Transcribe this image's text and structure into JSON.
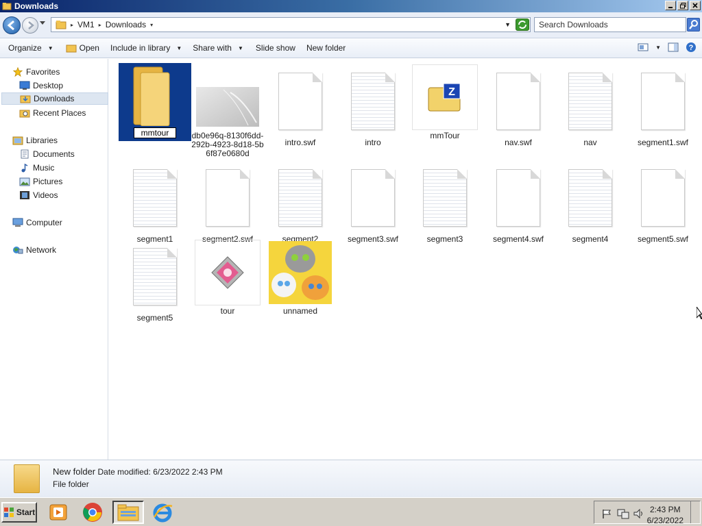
{
  "window": {
    "title": "Downloads"
  },
  "address": {
    "crumbs": [
      "VM1",
      "Downloads"
    ],
    "search_placeholder": "Search Downloads"
  },
  "toolbar": {
    "organize": "Organize",
    "open": "Open",
    "include_in_library": "Include in library",
    "share_with": "Share with",
    "slide_show": "Slide show",
    "new_folder": "New folder"
  },
  "nav": {
    "favorites": "Favorites",
    "desktop": "Desktop",
    "downloads": "Downloads",
    "recent_places": "Recent Places",
    "libraries": "Libraries",
    "documents": "Documents",
    "music": "Music",
    "pictures": "Pictures",
    "videos": "Videos",
    "computer": "Computer",
    "network": "Network"
  },
  "files": [
    {
      "name": "mmtour",
      "kind": "folder-renaming"
    },
    {
      "name": "db0e96q-8130f6dd-292b-4923-8d18-5b6f87e0680d",
      "kind": "image"
    },
    {
      "name": "intro.swf",
      "kind": "blank"
    },
    {
      "name": "intro",
      "kind": "lined"
    },
    {
      "name": "mmTour",
      "kind": "zip"
    },
    {
      "name": "nav.swf",
      "kind": "blank"
    },
    {
      "name": "nav",
      "kind": "lined"
    },
    {
      "name": "segment1.swf",
      "kind": "blank"
    },
    {
      "name": "segment1",
      "kind": "lined"
    },
    {
      "name": "segment2.swf",
      "kind": "blank"
    },
    {
      "name": "segment2",
      "kind": "lined"
    },
    {
      "name": "segment3.swf",
      "kind": "blank"
    },
    {
      "name": "segment3",
      "kind": "lined"
    },
    {
      "name": "segment4.swf",
      "kind": "blank"
    },
    {
      "name": "segment4",
      "kind": "lined"
    },
    {
      "name": "segment5.swf",
      "kind": "blank"
    },
    {
      "name": "segment5",
      "kind": "lined"
    },
    {
      "name": "tour",
      "kind": "app"
    },
    {
      "name": "unnamed",
      "kind": "photo"
    }
  ],
  "details": {
    "name": "New folder",
    "date_label": "Date modified:",
    "date_value": "6/23/2022 2:43 PM",
    "type": "File folder"
  },
  "taskbar": {
    "start": "Start",
    "time": "2:43 PM",
    "date": "6/23/2022"
  }
}
